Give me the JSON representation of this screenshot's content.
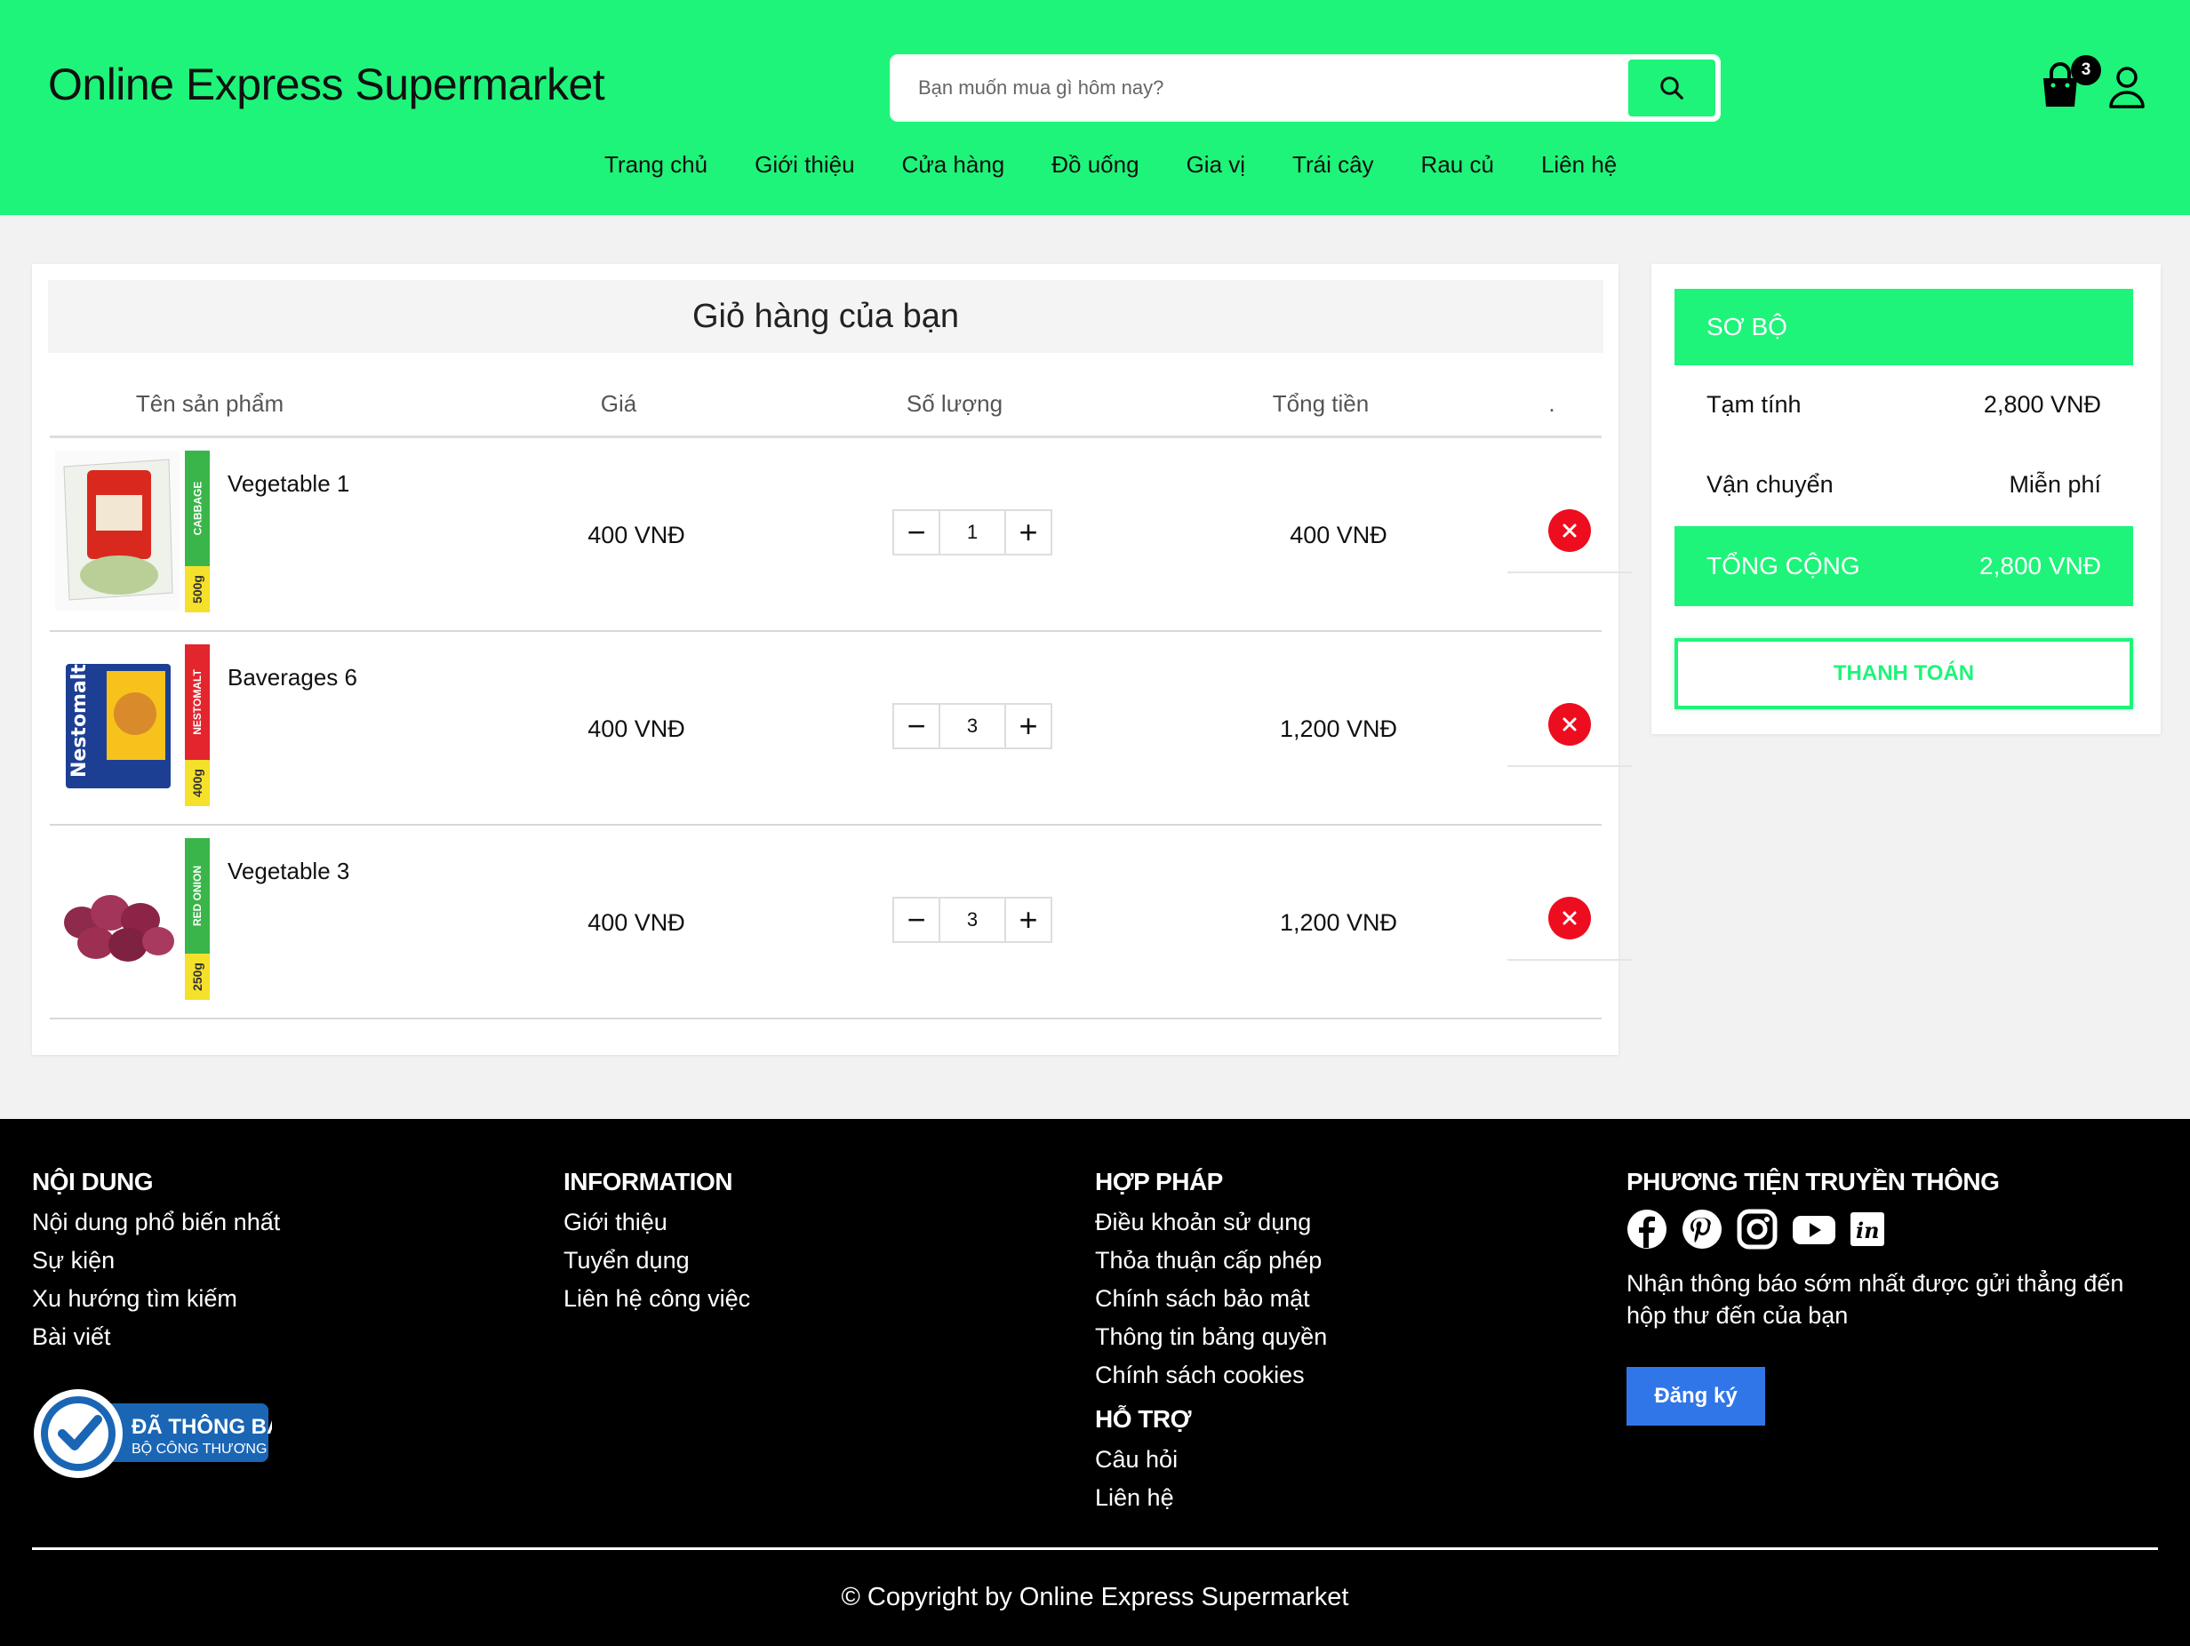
{
  "header": {
    "brand": "Online Express Supermarket",
    "search_placeholder": "Bạn muốn mua gì hôm nay?",
    "cart_count": "3",
    "accent_color": "#1ef479",
    "nav": [
      "Trang chủ",
      "Giới thiệu",
      "Cửa hàng",
      "Đồ uống",
      "Gia vị",
      "Trái cây",
      "Rau củ",
      "Liên hệ"
    ]
  },
  "cart": {
    "title": "Giỏ hàng của bạn",
    "columns": [
      "Tên sản phẩm",
      "Giá",
      "Số lượng",
      "Tổng tiền",
      "."
    ],
    "items": [
      {
        "name": "Vegetable 1",
        "tag": "CABBAGE",
        "tag_color": "#3ab54a",
        "weight": "500g",
        "price": "400 VNĐ",
        "qty": "1",
        "total": "400 VNĐ"
      },
      {
        "name": "Baverages 6",
        "tag": "NESTOMALT",
        "tag_color": "#e3262e",
        "weight": "400g",
        "price": "400 VNĐ",
        "qty": "3",
        "total": "1,200 VNĐ"
      },
      {
        "name": "Vegetable 3",
        "tag": "RED ONION",
        "tag_color": "#3ab54a",
        "weight": "250g",
        "price": "400 VNĐ",
        "qty": "3",
        "total": "1,200 VNĐ"
      }
    ],
    "minus": "−",
    "plus": "+"
  },
  "summary": {
    "heading": "SƠ BỘ",
    "subtotal_label": "Tạm tính",
    "subtotal_value": "2,800 VNĐ",
    "shipping_label": "Vận chuyển",
    "shipping_value": "Miễn phí",
    "total_label": "TỔNG CỘNG",
    "total_value": "2,800 VNĐ",
    "checkout_label": "THANH TOÁN"
  },
  "footer": {
    "col1": {
      "heading": "NỘI DUNG",
      "links": [
        "Nội dung phổ biến nhất",
        "Sự kiện",
        "Xu hướng tìm kiếm",
        "Bài viết"
      ]
    },
    "col2": {
      "heading": "INFORMATION",
      "links": [
        "Giới thiệu",
        "Tuyển dụng",
        "Liên hệ công việc"
      ]
    },
    "col3": {
      "heading": "HỢP PHÁP",
      "links": [
        "Điều khoản sử dụng",
        "Thỏa thuận cấp phép",
        "Chính sách bảo mật",
        "Thông tin bảng quyền",
        "Chính sách cookies"
      ]
    },
    "col3b": {
      "heading": "HỖ TRỢ",
      "links": [
        "Câu hỏi",
        "Liên hệ"
      ]
    },
    "col4": {
      "heading": "PHƯƠNG TIỆN TRUYỀN THÔNG",
      "social": [
        "facebook-icon",
        "pinterest-icon",
        "instagram-icon",
        "youtube-icon",
        "linkedin-icon"
      ],
      "note": "Nhận thông báo sớm nhất được gửi thẳng đến hộp thư đến của bạn",
      "subscribe": "Đăng ký"
    },
    "badge": {
      "line1": "ĐÃ THÔNG BÁO",
      "line2": "BỘ CÔNG THƯƠNG"
    },
    "copyright": "© Copyright by Online Express Supermarket"
  }
}
